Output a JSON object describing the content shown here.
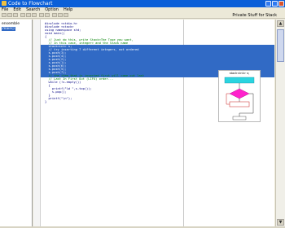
{
  "window": {
    "title": "Code to Flowchart"
  },
  "menu": [
    "File",
    "Edit",
    "Search",
    "Option",
    "Help"
  ],
  "toolbar": {
    "right_label": "Private Stuff for Stack"
  },
  "tree": {
    "items": [
      {
        "label": "ensemble",
        "selected": false
      },
      {
        "label": "main()",
        "selected": true
      }
    ]
  },
  "code": {
    "lines": [
      {
        "text": "#include <stdio.h>",
        "kind": "normal"
      },
      {
        "text": "#include <stack>",
        "kind": "normal"
      },
      {
        "text": "using namespace std;",
        "kind": "normal"
      },
      {
        "text": "void main()",
        "kind": "normal"
      },
      {
        "text": "{",
        "kind": "normal"
      },
      {
        "text": "  // Just do this, write Stack<The Type you want,",
        "kind": "comment"
      },
      {
        "text": "  // In this case, integer> and the stack name",
        "kind": "comment"
      },
      {
        "text": "  stack<int> s;",
        "kind": "selected"
      },
      {
        "text": "  // try inserting 7 different integers, not ordered",
        "kind": "selected"
      },
      {
        "text": "  s.push(3);",
        "kind": "selected"
      },
      {
        "text": "  s.push(4);",
        "kind": "selected"
      },
      {
        "text": "  s.push(2);",
        "kind": "selected"
      },
      {
        "text": "  s.push(1);",
        "kind": "selected"
      },
      {
        "text": "  s.push(6);",
        "kind": "selected"
      },
      {
        "text": "  s.push(5);",
        "kind": "selected"
      },
      {
        "text": "  s.push(7);",
        "kind": "selected"
      },
      {
        "text": "  // the item that is inserted first will come out last",
        "kind": "comment"
      },
      {
        "text": "  // Last In First Out (LIFO) order...",
        "kind": "comment"
      },
      {
        "text": "  while (!s.empty())",
        "kind": "normal"
      },
      {
        "text": "  {",
        "kind": "normal"
      },
      {
        "text": "    printf(\"%d \",s.top());",
        "kind": "normal"
      },
      {
        "text": "    s.pop();",
        "kind": "normal"
      },
      {
        "text": "  }",
        "kind": "normal"
      },
      {
        "text": "  printf(\"\\n\");",
        "kind": "normal"
      },
      {
        "text": "}",
        "kind": "normal"
      }
    ]
  },
  "flowchart": {
    "title": "stack<int> s;"
  },
  "colors": {
    "selection": "#316ac5",
    "titlebar": "#0a5fd8",
    "flow_process": "#2ad4e0",
    "flow_decision": "#ff22cc"
  }
}
